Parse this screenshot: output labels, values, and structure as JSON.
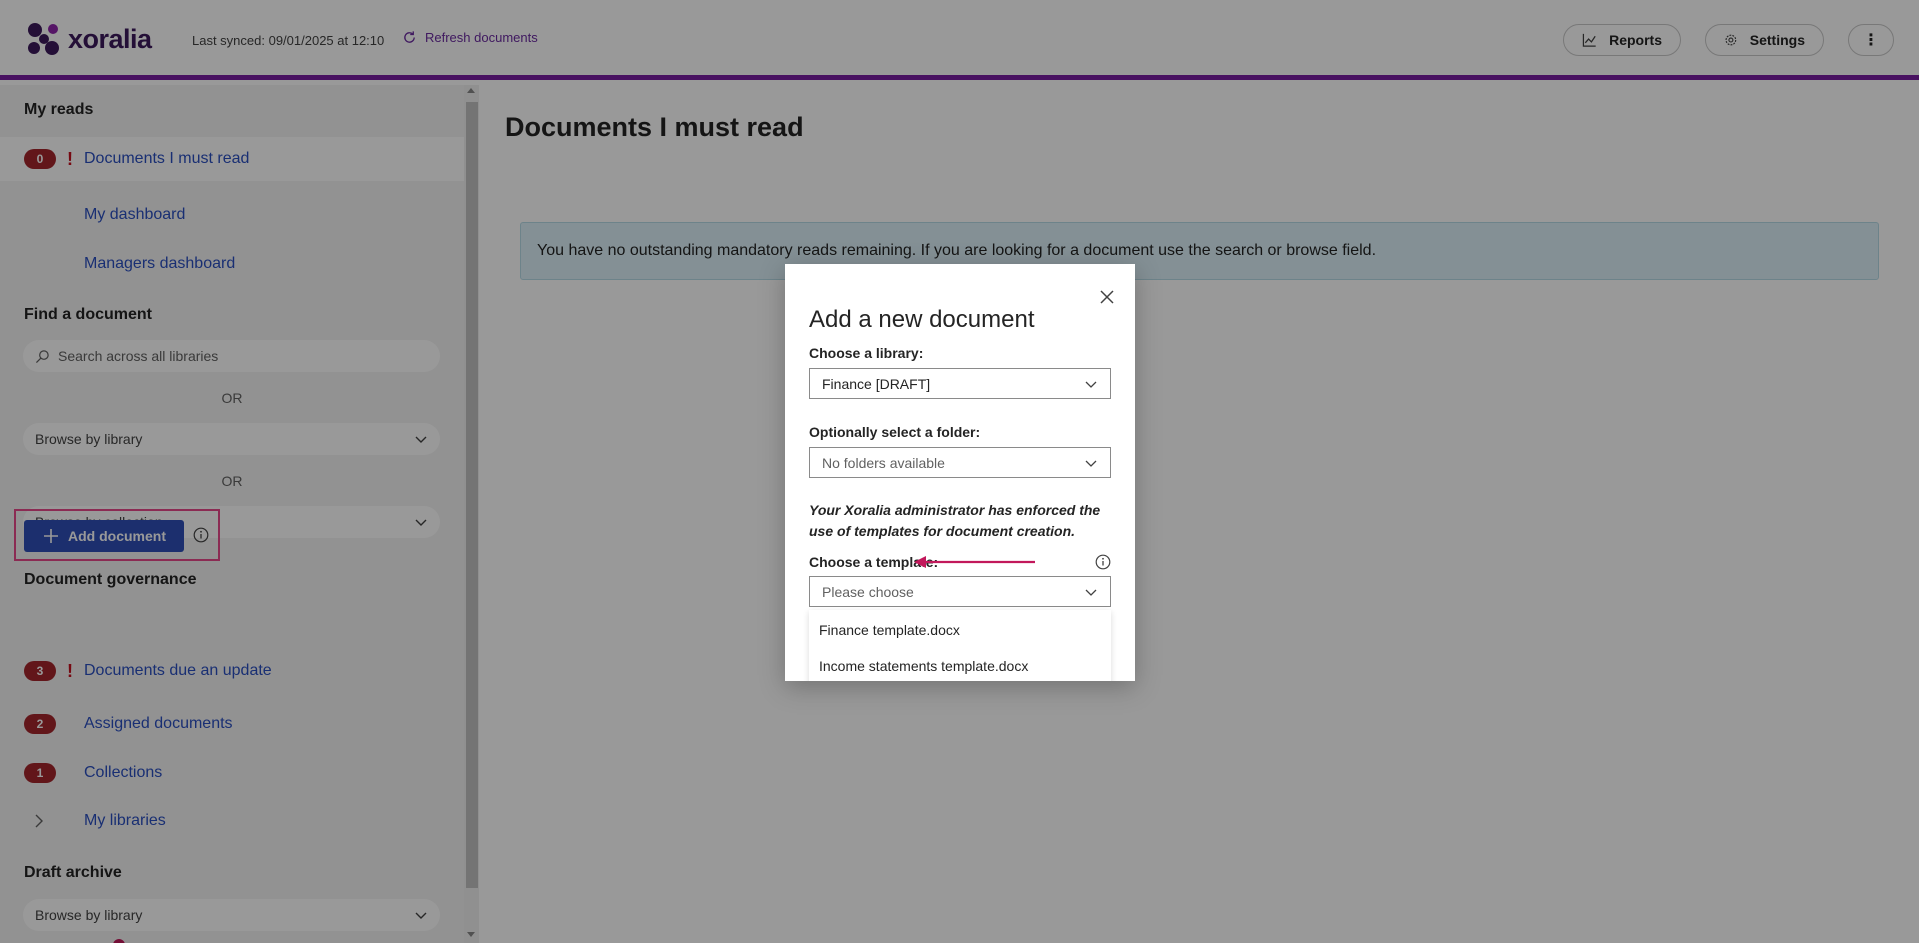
{
  "header": {
    "logo_text": "xoralia",
    "last_synced": "Last synced: 09/01/2025 at 12:10",
    "refresh_label": "Refresh documents",
    "reports_label": "Reports",
    "settings_label": "Settings",
    "more_label": "⋮",
    "accent_color": "#7b1fa2"
  },
  "sidebar": {
    "my_reads_heading": "My reads",
    "must_read": {
      "count": "0",
      "label": "Documents I must read"
    },
    "my_dashboard": "My dashboard",
    "managers_dashboard": "Managers dashboard",
    "find_heading": "Find a document",
    "search_placeholder": "Search across all libraries",
    "or_1": "OR",
    "browse_library": "Browse by library",
    "or_2": "OR",
    "browse_collection": "Browse by collection",
    "governance_heading": "Document governance",
    "add_document": "Add document",
    "due_update": {
      "count": "3",
      "label": "Documents due an update"
    },
    "assigned": {
      "count": "2",
      "label": "Assigned documents"
    },
    "collections": {
      "count": "1",
      "label": "Collections"
    },
    "my_libraries": "My libraries",
    "draft_heading": "Draft archive",
    "draft_browse_library": "Browse by library"
  },
  "main": {
    "title": "Documents I must read",
    "notice": "You have no outstanding mandatory reads remaining. If you are looking for a document use the search or browse field."
  },
  "modal": {
    "title": "Add a new document",
    "library_label": "Choose a library:",
    "library_value": "Finance [DRAFT]",
    "folder_label": "Optionally select a folder:",
    "folder_value": "No folders available",
    "note": "Your Xoralia administrator has enforced the use of templates for document creation.",
    "template_label": "Choose a template:",
    "template_value": "Please choose",
    "template_options": [
      "Finance template.docx",
      "Income statements template.docx"
    ],
    "annotation_color": "#c2185b"
  }
}
